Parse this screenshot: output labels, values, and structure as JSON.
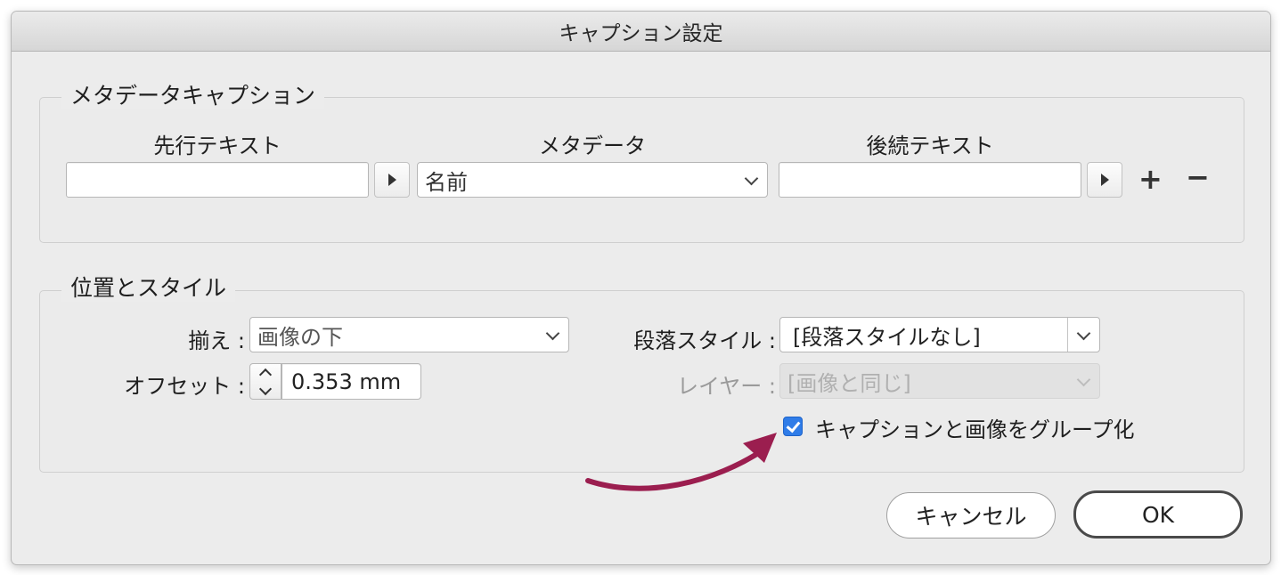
{
  "window": {
    "title": "キャプション設定"
  },
  "metadata_caption": {
    "legend": "メタデータキャプション",
    "col_prefix": "先行テキスト",
    "col_metadata": "メタデータ",
    "col_suffix": "後続テキスト",
    "prefix_value": "",
    "metadata_value": "名前",
    "suffix_value": "",
    "add_label": "+",
    "remove_label": "−"
  },
  "position_style": {
    "legend": "位置とスタイル",
    "align_label": "揃え :",
    "align_value": "画像の下",
    "offset_label": "オフセット :",
    "offset_value": "0.353 mm",
    "paragraph_style_label": "段落スタイル :",
    "paragraph_style_value": "[段落スタイルなし]",
    "layer_label": "レイヤー :",
    "layer_value": "[画像と同じ]",
    "group_checkbox_label": "キャプションと画像をグループ化",
    "group_checked": true
  },
  "buttons": {
    "cancel": "キャンセル",
    "ok": "OK"
  },
  "colors": {
    "accent": "#2f7ce8",
    "annotation_arrow": "#9b1e4f"
  },
  "icons": [
    "triangle-right-icon",
    "chevron-down-icon",
    "stepper-icon",
    "checkmark-icon",
    "plus-icon",
    "minus-icon"
  ]
}
